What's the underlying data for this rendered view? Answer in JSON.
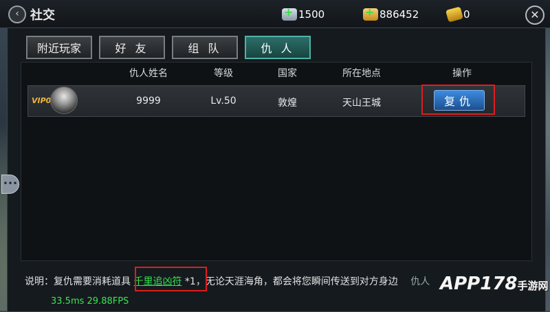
{
  "header": {
    "title": "社交",
    "resources": [
      {
        "icon": "silver-ingot-add-icon",
        "value": "1500"
      },
      {
        "icon": "gold-ingot-add-icon",
        "value": "886452"
      },
      {
        "icon": "ticket-icon",
        "value": "0"
      }
    ]
  },
  "tabs": [
    {
      "label": "附近玩家",
      "active": false
    },
    {
      "label": "好 友",
      "active": false
    },
    {
      "label": "组 队",
      "active": false
    },
    {
      "label": "仇 人",
      "active": true
    }
  ],
  "table": {
    "columns": [
      "仇人姓名",
      "等级",
      "国家",
      "所在地点",
      "操作"
    ],
    "rows": [
      {
        "vip": "VIP0",
        "name": "9999",
        "level": "Lv.50",
        "country": "敦煌",
        "location": "天山王城",
        "action": "复仇"
      }
    ]
  },
  "description": {
    "prefix": "说明：复仇需要消耗道具",
    "item": "千里追凶符",
    "suffix": "*1，无论天涯海角，都会将您瞬间传送到对方身边",
    "tail": "仇人"
  },
  "debug": {
    "fps": "33.5ms 29.88FPS"
  },
  "watermark": {
    "brand": "APP178",
    "sub": "手游网"
  },
  "colors": {
    "accent_green": "#30e54c",
    "highlight_red": "#e01d1d",
    "button_blue": "#2a6fc0"
  }
}
